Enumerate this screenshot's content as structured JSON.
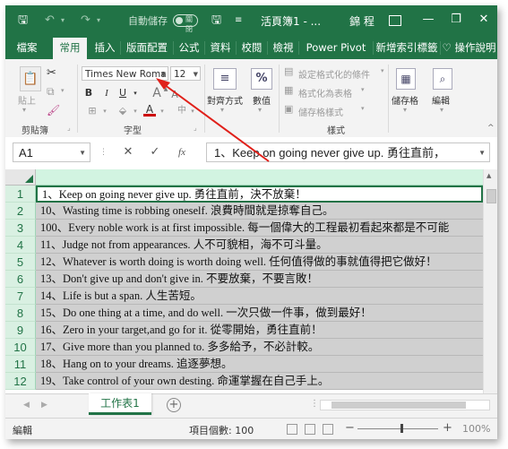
{
  "titlebar": {
    "autosave_label": "自動儲存",
    "autosave_state": "關閉",
    "doc_title": "活頁簿1 - ...",
    "account": "錦 程"
  },
  "tabs": [
    "檔案",
    "常用",
    "插入",
    "版面配置",
    "公式",
    "資料",
    "校閱",
    "檢視",
    "Power Pivot",
    "新增索引標籤",
    "操作說明"
  ],
  "ribbon": {
    "paste_label": "貼上",
    "clipboard_group": "剪貼簿",
    "font_name": "Times New Roma",
    "font_size": "12",
    "font_group": "字型",
    "align_label": "對齊方式",
    "number_label": "數值",
    "cond_format": "設定格式化的條件",
    "table_format": "格式化為表格",
    "cell_styles": "儲存格樣式",
    "styles_group": "樣式",
    "cells_label": "儲存格",
    "editing_label": "編輯",
    "bold": "B",
    "italic": "I",
    "underline": "U",
    "percent": "%"
  },
  "formula_bar": {
    "name_box": "A1",
    "cancel": "✕",
    "enter": "✓",
    "fx": "fx",
    "content": "1、Keep on going never give up. 勇往直前，"
  },
  "rows": [
    {
      "num": "1",
      "text": "1、Keep on going never give up. 勇往直前，決不放棄！"
    },
    {
      "num": "2",
      "text": "10、Wasting time is robbing oneself. 浪費時間就是掠奪自己。"
    },
    {
      "num": "3",
      "text": "100、Every noble work is at first impossible. 每一個偉大的工程最初看起來都是不可能"
    },
    {
      "num": "4",
      "text": "11、Judge not from appearances. 人不可貌相，海不可斗量。"
    },
    {
      "num": "5",
      "text": "12、Whatever is worth doing is worth doing well. 任何值得做的事就值得把它做好！"
    },
    {
      "num": "6",
      "text": "13、Don't give up and don't give in. 不要放棄，不要言敗！"
    },
    {
      "num": "7",
      "text": "14、Life is but a span. 人生苦短。"
    },
    {
      "num": "8",
      "text": "15、Do one thing at a time, and do well. 一次只做一件事，做到最好！"
    },
    {
      "num": "9",
      "text": "16、Zero in your target,and go for it. 從零開始，勇往直前！"
    },
    {
      "num": "10",
      "text": "17、Give more than you planned to. 多多給予，不必計較。"
    },
    {
      "num": "11",
      "text": "18、Hang on to your dreams. 追逐夢想。"
    },
    {
      "num": "12",
      "text": "19、Take control of your own desting. 命運掌握在自己手上。"
    }
  ],
  "sheet_tab": "工作表1",
  "status": {
    "mode": "編輯",
    "count": "項目個數: 100",
    "zoom": "100%"
  },
  "colors": {
    "accent": "#217346",
    "row_header_bg": "#d9f0e2",
    "selection_bg": "#d0d0d0",
    "annotation": "#e0201a"
  }
}
